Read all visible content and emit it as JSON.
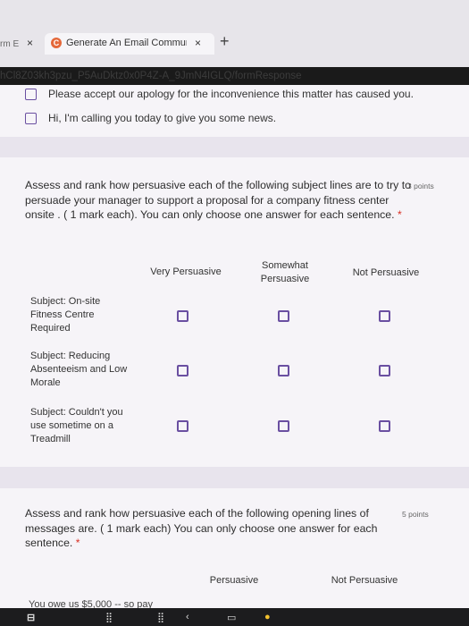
{
  "browser": {
    "prev_tab_fragment": "rm E",
    "tab_close": "×",
    "active_tab_icon": "C",
    "active_tab_title": "Generate An Email Communicati",
    "new_tab": "+",
    "url": "hCl8Z03kh3pzu_P5AuDktz0x0P4Z-A_9JmN4IGLQ/formResponse"
  },
  "prev_question": {
    "options": [
      "Please accept our apology for the inconvenience this matter has caused you.",
      "Hi, I'm calling you today to give you some news."
    ]
  },
  "question1": {
    "text": "Assess and rank how persuasive each of the following subject lines are to try to persuade your manager to support a proposal for a company fitness center onsite . ( 1 mark each). You can only choose one answer for each sentence.",
    "required_mark": "*",
    "points": "3 points",
    "columns": [
      "Very Persuasive",
      "Somewhat Persuasive",
      "Not Persuasive"
    ],
    "rows": [
      "Subject: On-site Fitness Centre Required",
      "Subject: Reducing Absenteeism and Low Morale",
      "Subject: Couldn't you use sometime on a Treadmill"
    ]
  },
  "question2": {
    "text": "Assess and rank how persuasive each of the following opening lines of messages are. ( 1 mark each) You can only choose one answer for each sentence.",
    "required_mark": "*",
    "points": "5 points",
    "columns": [
      "Persuasive",
      "Not Persuasive"
    ],
    "first_row_fragment": "You owe us $5,000 -- so pay"
  },
  "taskbar": {
    "icons": [
      "app-icon",
      "grid-icon",
      "back-arrow-icon",
      "tv-icon",
      "chrome-icon"
    ]
  },
  "colors": {
    "accent": "#6a4fa1",
    "page_bg": "#e8e4ed",
    "card_bg": "#f6f4f8",
    "required": "#d93025"
  }
}
